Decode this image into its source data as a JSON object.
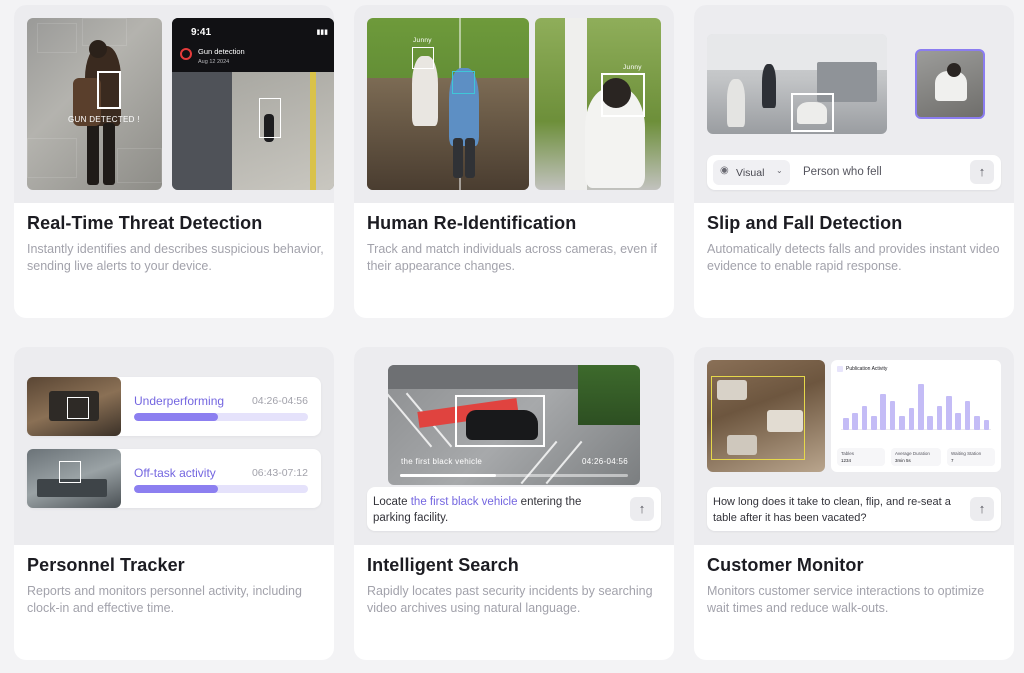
{
  "cards": [
    {
      "title": "Real-Time Threat Detection",
      "description": "Instantly identifies and describes suspicious behavior, sending live alerts to your device.",
      "overlay_label": "GUN DETECTED !",
      "phone": {
        "time": "9:41",
        "alert_title": "Gun detection",
        "alert_date": "Aug 12 2024"
      }
    },
    {
      "title": "Human Re-Identification",
      "description": "Track and match individuals across cameras, even if their appearance changes.",
      "person_label_1": "Junny",
      "person_label_2": "Junny"
    },
    {
      "title": "Slip and Fall Detection",
      "description": "Automatically detects falls and provides instant video evidence to enable rapid response.",
      "mode_label": "Visual",
      "query_text": "Person who fell"
    },
    {
      "title": "Personnel Tracker",
      "description": "Reports and monitors personnel activity, including clock-in and effective time.",
      "rows": [
        {
          "label": "Underperforming",
          "time": "04:26-04:56",
          "progress": 0.48
        },
        {
          "label": "Off-task activity",
          "time": "06:43-07:12",
          "progress": 0.48
        }
      ]
    },
    {
      "title": "Intelligent Search",
      "description": "Rapidly locates past security incidents by searching video archives using natural language.",
      "video_caption": "the first black vehicle",
      "video_time": "04:26-04:56",
      "video_progress": 0.42,
      "query_prefix": "Locate ",
      "query_highlight": "the first black vehicle",
      "query_suffix": " entering the parking facility."
    },
    {
      "title": "Customer Monitor",
      "description": "Monitors customer service interactions to optimize wait times and reduce walk-outs.",
      "dashboard": {
        "title": "Publication Activity",
        "bar_levels": [
          0.25,
          0.35,
          0.5,
          0.3,
          0.75,
          0.6,
          0.3,
          0.45,
          0.95,
          0.3,
          0.5,
          0.7,
          0.35,
          0.6,
          0.3,
          0.2
        ],
        "stats": [
          {
            "label": "Tables",
            "value": "1234"
          },
          {
            "label": "Average Duration",
            "value": "3min 5s"
          },
          {
            "label": "Waiting Station",
            "value": "7"
          }
        ]
      },
      "query_text": "How long does it take to clean, flip, and re-seat a table after it has been vacated?"
    }
  ],
  "colors": {
    "accent": "#8c7ff0",
    "accent_text": "#7466e0",
    "alert": "#e43b3b"
  },
  "icons": {
    "send": "arrow-up-icon",
    "eye": "eye-icon",
    "chevron": "chevron-down-icon",
    "alert": "alert-circle-icon"
  }
}
